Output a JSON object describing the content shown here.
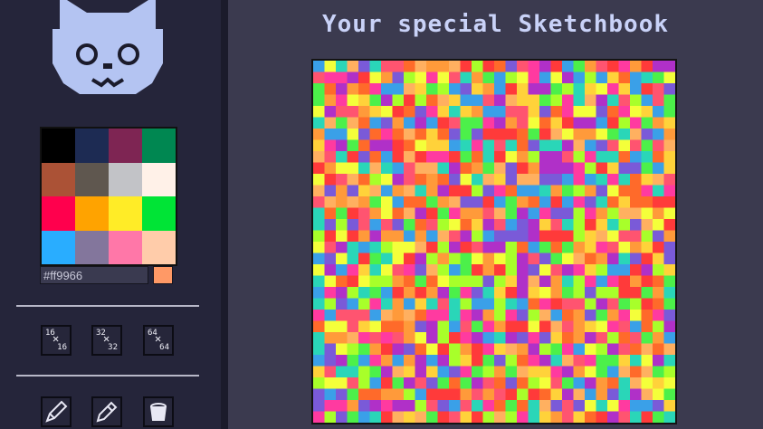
{
  "header": {
    "title": "Your special Sketchbook"
  },
  "palette": {
    "colors": [
      "#000000",
      "#1d2b53",
      "#7e2553",
      "#008751",
      "#ab5236",
      "#5f574f",
      "#c2c3c7",
      "#fff1e8",
      "#ff004d",
      "#ffa300",
      "#ffec27",
      "#00e436",
      "#29adff",
      "#83769c",
      "#ff77a8",
      "#ffccaa"
    ]
  },
  "color_input": {
    "value": "#ff9966"
  },
  "current_color": "#ff9966",
  "canvas_sizes": [
    {
      "top": "16",
      "bottom": "16"
    },
    {
      "top": "32",
      "bottom": "32"
    },
    {
      "top": "64",
      "bottom": "64"
    }
  ],
  "tools": {
    "pencil": "pencil-icon",
    "pen": "pen-icon",
    "bucket": "bucket-icon"
  },
  "canvas": {
    "grid": 32,
    "colors": [
      "#ff3a3a",
      "#ff6a2a",
      "#ff9a3a",
      "#ffd23a",
      "#f4ff3a",
      "#a8ff2a",
      "#4cf04a",
      "#2ad6b8",
      "#3aa0e8",
      "#7a5ad8",
      "#b030c8",
      "#ff3aa0",
      "#ff5470",
      "#ffb060"
    ]
  }
}
